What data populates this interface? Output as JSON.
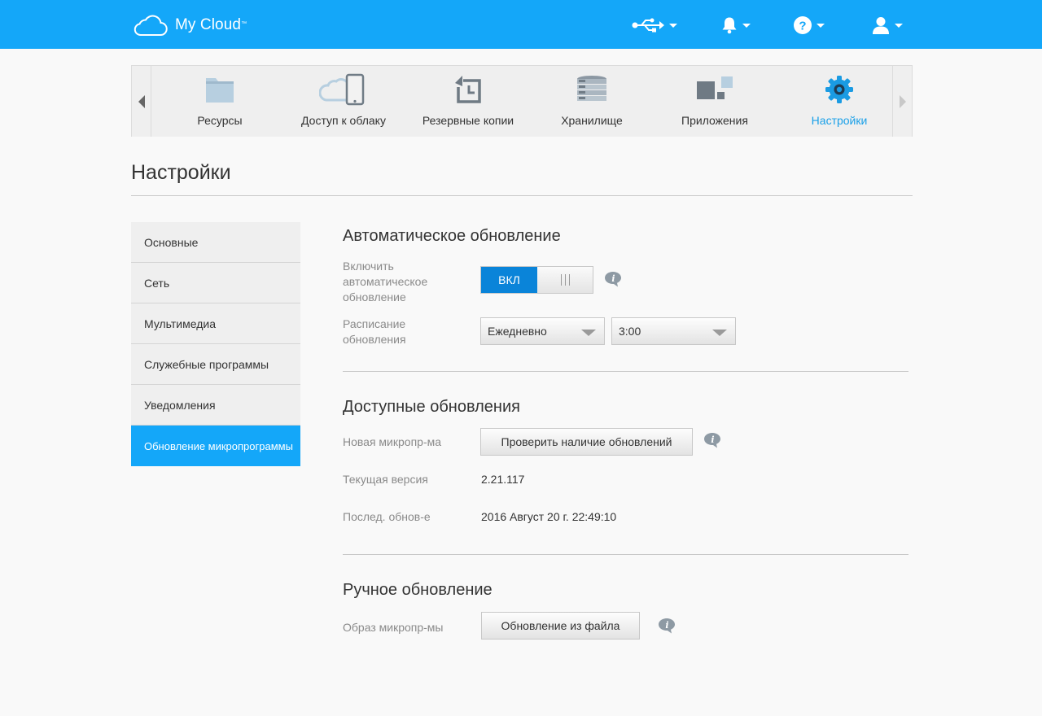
{
  "header": {
    "logo_text": "My Cloud",
    "logo_tm": "™",
    "accent_color": "#14a7f9",
    "icons": [
      "usb-icon",
      "bell-icon",
      "help-icon",
      "user-icon"
    ]
  },
  "nav": {
    "items": [
      {
        "label": "Ресурсы",
        "icon": "folder-icon"
      },
      {
        "label": "Доступ к облаку",
        "icon": "cloud-phone-icon"
      },
      {
        "label": "Резервные копии",
        "icon": "backup-icon"
      },
      {
        "label": "Хранилище",
        "icon": "storage-icon"
      },
      {
        "label": "Приложения",
        "icon": "apps-icon"
      },
      {
        "label": "Настройки",
        "icon": "gear-icon",
        "active": true
      }
    ]
  },
  "page": {
    "title": "Настройки"
  },
  "sidebar": {
    "items": [
      {
        "label": "Основные"
      },
      {
        "label": "Сеть"
      },
      {
        "label": "Мультимедиа"
      },
      {
        "label": "Служебные программы"
      },
      {
        "label": "Уведомления"
      },
      {
        "label": "Обновление микропрограммы",
        "active": true
      }
    ]
  },
  "auto_update": {
    "title": "Автоматическое обновление",
    "enable_label": "Включить автоматическое обновление",
    "toggle_on_label": "ВКЛ",
    "toggle_state": "on",
    "schedule_label": "Расписание обновления",
    "schedule_frequency": "Ежедневно",
    "schedule_time": "3:00"
  },
  "available_updates": {
    "title": "Доступные обновления",
    "new_firmware_label": "Новая микропр-ма",
    "check_button": "Проверить наличие обновлений",
    "current_version_label": "Текущая версия",
    "current_version": "2.21.117",
    "last_update_label": "Послед. обнов-е",
    "last_update": "2016 Август 20 г. 22:49:10"
  },
  "manual_update": {
    "title": "Ручное обновление",
    "image_label": "Образ микропр-мы",
    "file_button": "Обновление из файла"
  }
}
